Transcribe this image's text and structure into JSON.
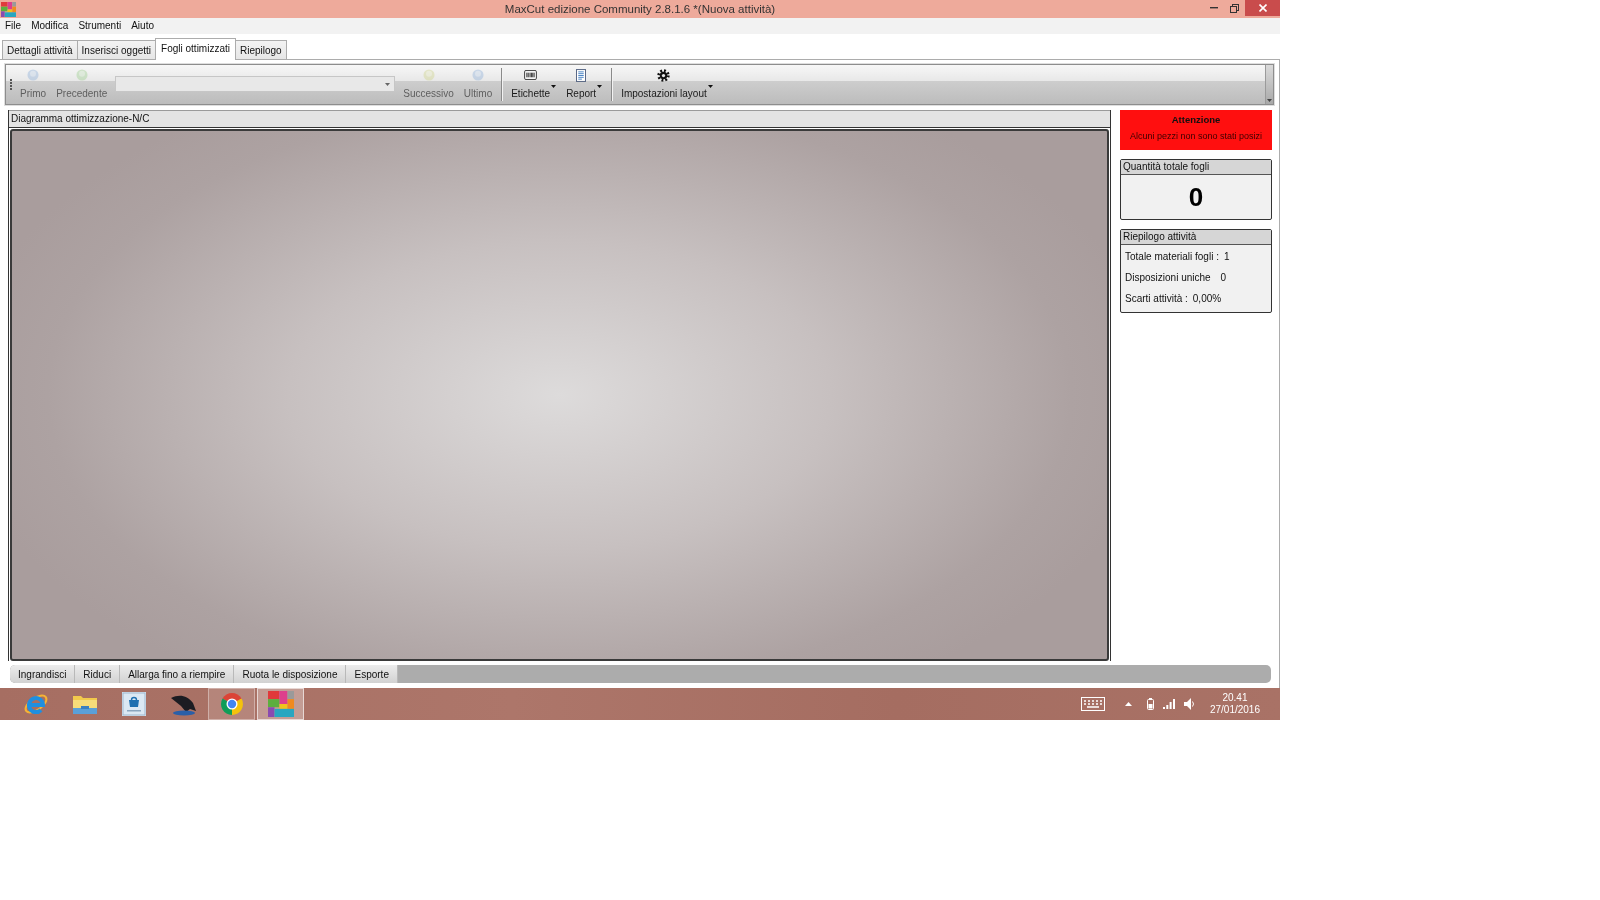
{
  "window": {
    "title": "MaxCut edizione Community 2.8.1.6 *(Nuova attività)"
  },
  "menu": [
    "File",
    "Modifica",
    "Strumenti",
    "Aiuto"
  ],
  "tabs": [
    {
      "label": "Dettagli attività",
      "selected": false
    },
    {
      "label": "Inserisci oggetti",
      "selected": false
    },
    {
      "label": "Fogli ottimizzati",
      "selected": true
    },
    {
      "label": "Riepilogo",
      "selected": false
    }
  ],
  "toolbar": {
    "groups": [
      [
        {
          "kind": "button",
          "label": "Primo",
          "disabled": true
        },
        {
          "kind": "button",
          "label": "Precedente",
          "disabled": true
        },
        {
          "kind": "combo",
          "disabled": true
        },
        {
          "kind": "button",
          "label": "Successivo",
          "disabled": true
        },
        {
          "kind": "button",
          "label": "Ultimo",
          "disabled": true
        }
      ],
      [
        {
          "kind": "menu",
          "label": "Etichette",
          "disabled": false
        },
        {
          "kind": "menu",
          "label": "Report",
          "disabled": false
        }
      ],
      [
        {
          "kind": "menu",
          "label": "Impostazioni layout",
          "disabled": false
        }
      ]
    ]
  },
  "diagram": {
    "title": "Diagramma ottimizzazione-N/C"
  },
  "alert": {
    "title": "Attenzione",
    "message": "Alcuni pezzi non sono stati posizi"
  },
  "sheet_total": {
    "title": "Quantità totale fogli",
    "value": "0"
  },
  "summary": {
    "title": "Riepilogo attività",
    "rows": [
      {
        "label": "Totale materiali fogli :",
        "value": "1"
      },
      {
        "label": "Disposizioni uniche",
        "value": "0"
      },
      {
        "label": "Scarti attività :",
        "value": "0,00%"
      }
    ]
  },
  "view_buttons": [
    "Ingrandisci",
    "Riduci",
    "Allarga fino a riempire",
    "Ruota le disposizione",
    "Esporte"
  ],
  "taskbar": {
    "apps": [
      {
        "running": false,
        "selected": false
      },
      {
        "running": false,
        "selected": false
      },
      {
        "running": false,
        "selected": false
      },
      {
        "running": false,
        "selected": false
      },
      {
        "running": true,
        "selected": false
      },
      {
        "running": true,
        "selected": true
      }
    ],
    "clock": {
      "time": "20.41",
      "date": "27/01/2016"
    }
  }
}
